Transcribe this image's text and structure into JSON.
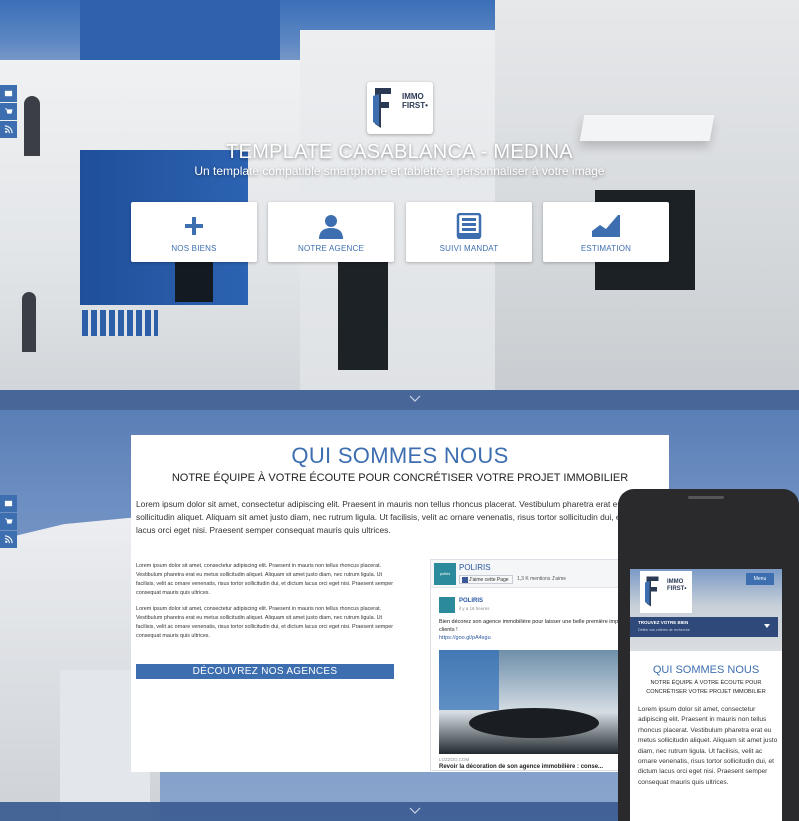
{
  "colors": {
    "accent": "#3d6fb0",
    "band": "#3e5f94",
    "brand_dark": "#2a3a55"
  },
  "side_tabs": [
    {
      "name": "email-icon"
    },
    {
      "name": "cart-icon"
    },
    {
      "name": "rss-icon"
    }
  ],
  "logo": {
    "line1": "IMMO",
    "line2": "FIRST•"
  },
  "hero": {
    "title": "TEMPLATE CASABLANCA - MEDINA",
    "subtitle": "Un template compatible smartphone et tablette à personnaliser à votre image"
  },
  "quick_links": [
    {
      "label": "NOS BIENS",
      "icon": "plus-icon"
    },
    {
      "label": "NOTRE AGENCE",
      "icon": "user-icon"
    },
    {
      "label": "SUIVI MANDAT",
      "icon": "archive-icon"
    },
    {
      "label": "ESTIMATION",
      "icon": "chart-icon"
    }
  ],
  "about": {
    "title": "QUI SOMMES NOUS",
    "subtitle": "NOTRE ÉQUIPE À VOTRE ÉCOUTE POUR CONCRÉTISER VOTRE PROJET IMMOBILIER",
    "lead": "Lorem ipsum dolor sit amet, consectetur adipiscing elit. Praesent in mauris non tellus rhoncus placerat. Vestibulum pharetra erat eu metus sollicitudin aliquet. Aliquam sit amet justo diam, nec rutrum ligula. Ut facilisis, velit ac ornare venenatis, risus tortor sollicitudin dui, et dictum lacus orci eget nisi. Praesent semper consequat mauris quis ultrices.",
    "para1": "Lorem ipsum dolor sit amet, consectetur adipiscing elit. Praesent in mauris non tellus rhoncus placerat. Vestibulum pharetra erat eu metus sollicitudin aliquet. Aliquam sit amet justo diam, nec rutrum ligula. Ut facilisis, velit ac ornare venenatis, risus tortor sollicitudin dui, et dictum lacus orci eget nisi. Praesent semper consequat mauris quis ultrices.",
    "para2": "Lorem ipsum dolor sit amet, consectetur adipiscing elit. Praesent in mauris non tellus rhoncus placerat. Vestibulum pharetra erat eu metus sollicitudin aliquet. Aliquam sit amet justo diam, nec rutrum ligula. Ut facilisis, velit ac ornare venenatis, risus tortor sollicitudin dui, et dictum lacus orci eget nisi. Praesent semper consequat mauris quis ultrices.",
    "button": "DÉCOUVREZ NOS AGENCES"
  },
  "facebook": {
    "page_name": "POLIRIS",
    "like_label": "J'aime cette Page",
    "likes": "1,3 K mentions J'aime",
    "avatar_text": "poliris",
    "post_author": "POLIRIS",
    "post_time": "il y a 16 heures",
    "post_text": "Bien décorez son agence immobilière pour laisser une belle première impression à vos clients !",
    "post_link": "https://goo.gl/pA4sgu",
    "source": "LOZZOO.COM",
    "caption": "Revoir la décoration de son agence immobilière : conse..."
  },
  "phone": {
    "logo_line1": "IMMO",
    "logo_line2": "FIRST•",
    "menu": "Menu",
    "search_title": "TROUVEZ VOTRE BIEN",
    "search_hint": "Définir vos critères de recherche",
    "title": "QUI SOMMES NOUS",
    "subtitle": "NOTRE ÉQUIPE À VOTRE ÉCOUTE POUR CONCRÉTISER VOTRE PROJET IMMOBILIER",
    "text": "Lorem ipsum dolor sit amet, consectetur adipiscing elit. Praesent in mauris non tellus rhoncus placerat. Vestibulum pharetra erat eu metus sollicitudin aliquet. Aliquam sit amet justo diam, nec rutrum ligula. Ut facilisis, velit ac ornare venenatis, risus tortor sollicitudin dui, et dictum lacus orci eget nisi. Praesent semper consequat mauris quis ultrices."
  }
}
